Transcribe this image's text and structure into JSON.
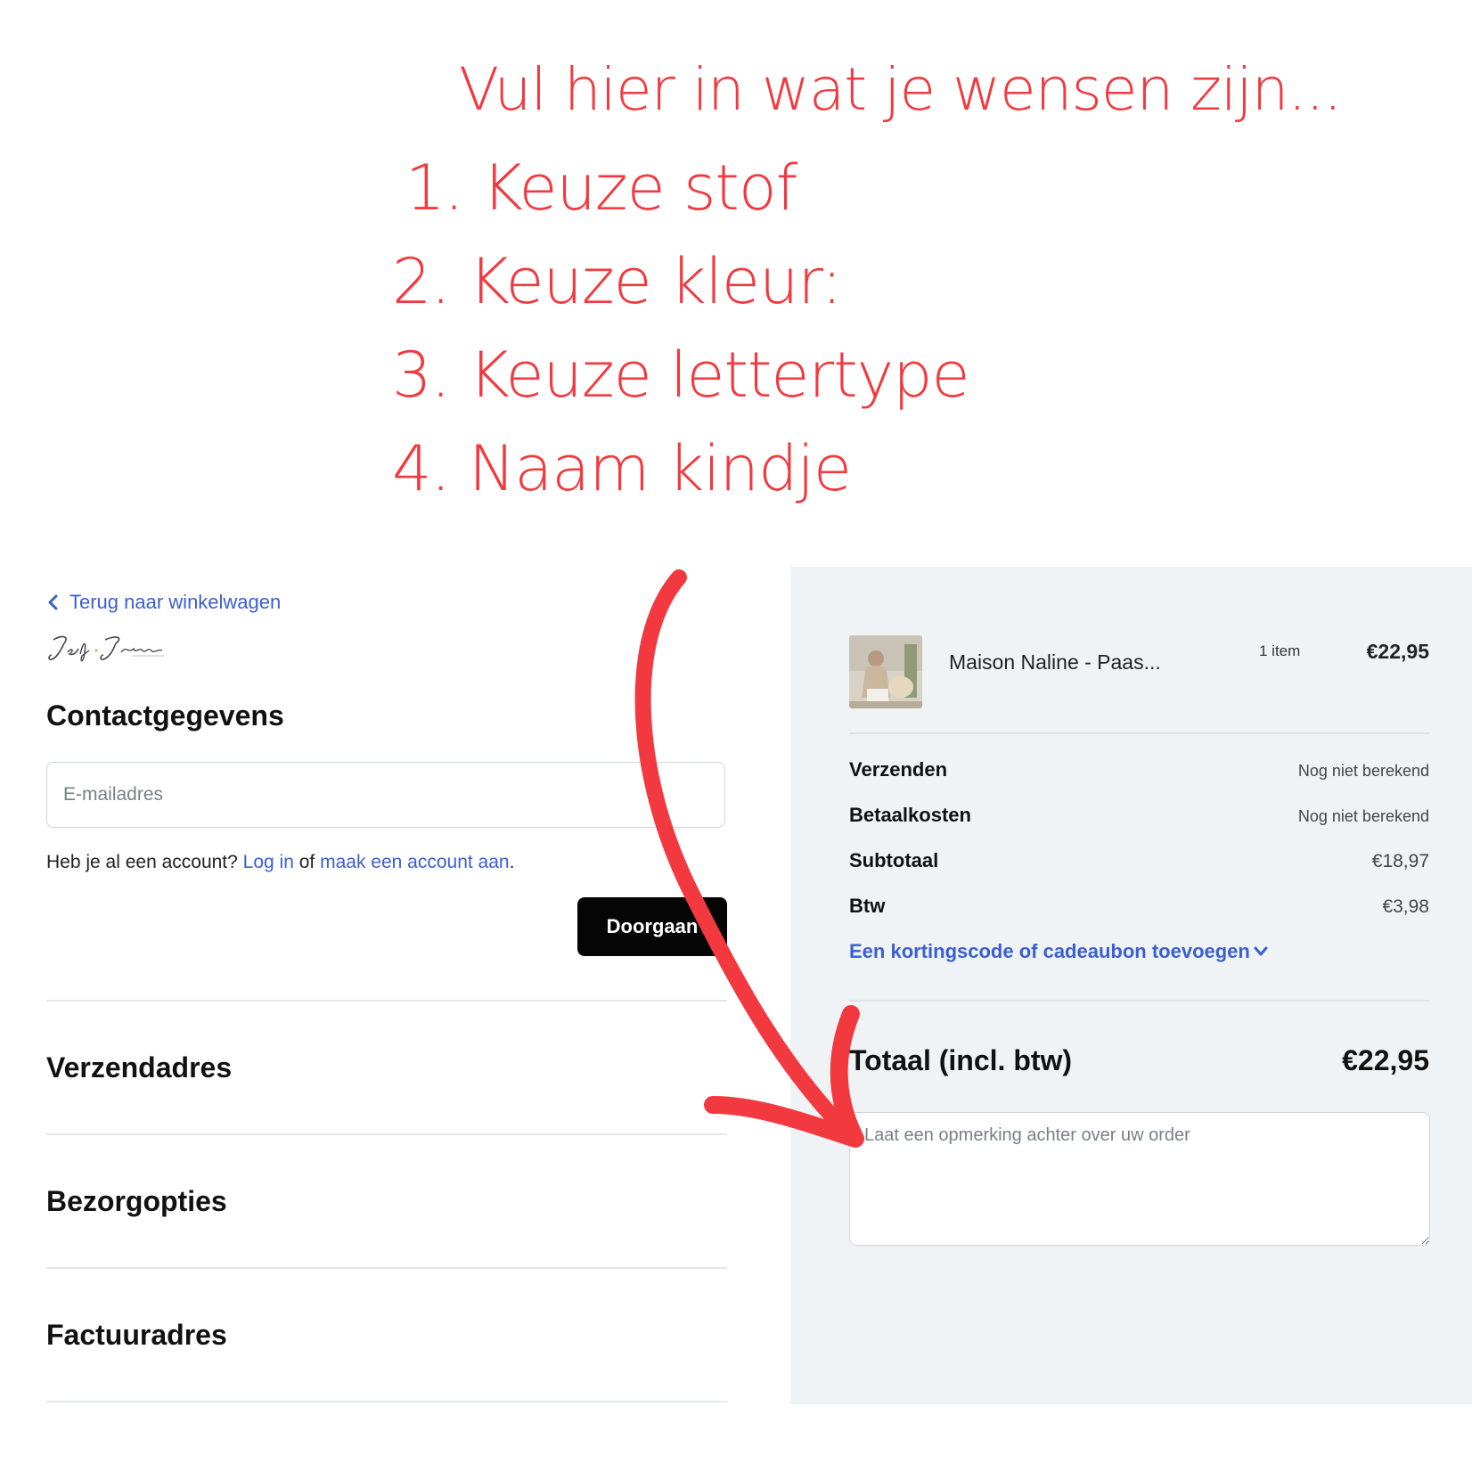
{
  "instructions": {
    "title": "Vul hier in wat je wensen zijn...",
    "steps": [
      "1. Keuze stof",
      "2. Keuze kleur:",
      "3. Keuze lettertype",
      "4. Naam kindje"
    ]
  },
  "checkout": {
    "back_link": "Terug naar winkelwagen",
    "logo_alt": "Jef & Jeanne",
    "contact_title": "Contactgegevens",
    "email_placeholder": "E-mailadres",
    "account_prefix": "Heb je al een account?",
    "login_link": "Log in",
    "account_or": "of",
    "create_account_link": "maak een account aan",
    "account_suffix": ".",
    "continue_button": "Doorgaan",
    "sections": [
      "Verzendadres",
      "Bezorgopties",
      "Factuuradres"
    ]
  },
  "summary": {
    "product": {
      "name": "Maison Naline - Paas...",
      "quantity": "1 item",
      "price": "€22,95"
    },
    "rows": [
      {
        "label": "Verzenden",
        "value": "Nog niet berekend"
      },
      {
        "label": "Betaalkosten",
        "value": "Nog niet berekend"
      },
      {
        "label": "Subtotaal",
        "value": "€18,97"
      },
      {
        "label": "Btw",
        "value": "€3,98"
      }
    ],
    "discount_link": "Een kortingscode of cadeaubon toevoegen",
    "total_label": "Totaal (incl. btw)",
    "total_value": "€22,95",
    "remark_placeholder": "Laat een opmerking achter over uw order"
  },
  "colors": {
    "accent_red": "#f2393f",
    "link_blue": "#3a5fd0",
    "panel_bg": "#f0f3f6",
    "button_bg": "#050505"
  }
}
